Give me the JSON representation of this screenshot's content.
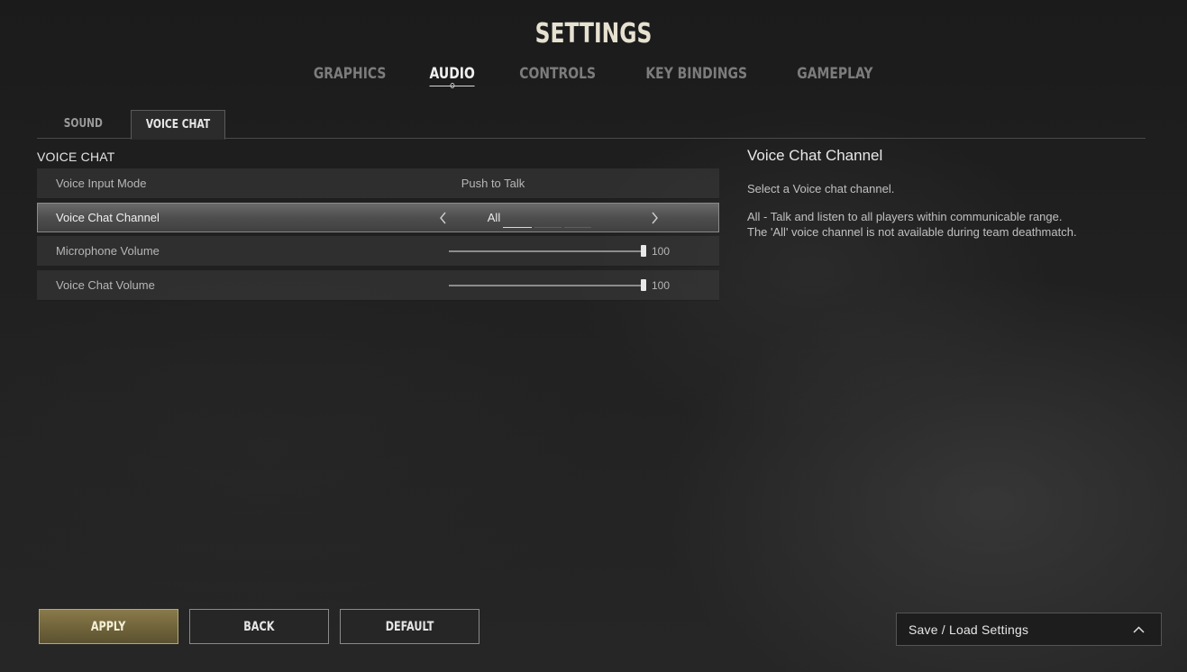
{
  "page": {
    "title": "SETTINGS"
  },
  "main_tabs": [
    {
      "label": "GRAPHICS",
      "active": false
    },
    {
      "label": "AUDIO",
      "active": true
    },
    {
      "label": "CONTROLS",
      "active": false
    },
    {
      "label": "KEY BINDINGS",
      "active": false
    },
    {
      "label": "GAMEPLAY",
      "active": false
    }
  ],
  "sub_tabs": [
    {
      "label": "SOUND",
      "active": false
    },
    {
      "label": "VOICE CHAT",
      "active": true
    }
  ],
  "section": {
    "heading": "VOICE CHAT"
  },
  "settings": {
    "voice_input_mode": {
      "label": "Voice Input Mode",
      "value": "Push to Talk"
    },
    "voice_chat_channel": {
      "label": "Voice Chat Channel",
      "value": "All",
      "option_count": 3,
      "selected_index": 0
    },
    "microphone_volume": {
      "label": "Microphone Volume",
      "value": "100",
      "level_percent": 100
    },
    "voice_chat_volume": {
      "label": "Voice Chat Volume",
      "value": "100",
      "level_percent": 100
    }
  },
  "description": {
    "title": "Voice Chat Channel",
    "line1": "Select a Voice chat channel.",
    "line2": "All - Talk and listen to all players within communicable range.",
    "line3": "The 'All' voice channel is not available during team deathmatch."
  },
  "buttons": {
    "apply": "APPLY",
    "back": "BACK",
    "default": "DEFAULT"
  },
  "save_load": {
    "label": "Save / Load Settings",
    "icon": "chevron-up-icon"
  },
  "colors": {
    "accent_gold": "#8a7a4a",
    "active_text": "#f0f0f0",
    "inactive_text": "#7c7c7c"
  }
}
